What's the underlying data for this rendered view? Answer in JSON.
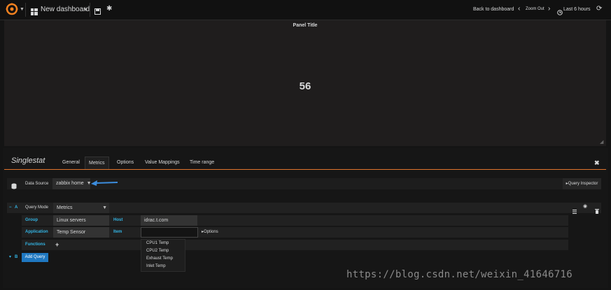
{
  "topnav": {
    "dashboard_title": "New dashboard",
    "back_label": "Back to dashboard",
    "zoom_out_label": "Zoom Out",
    "time_range_label": "Last 6 hours"
  },
  "panel": {
    "title": "Panel Title",
    "value": "56"
  },
  "editor": {
    "panel_type": "Singlestat",
    "tabs": [
      "General",
      "Metrics",
      "Options",
      "Value Mappings",
      "Time range"
    ],
    "active_tab": "Metrics",
    "data_source_label": "Data Source",
    "data_source_value": "zabbix home",
    "query_inspector_label": "Query Inspector"
  },
  "query": {
    "ref_id": "A",
    "query_mode_label": "Query Mode",
    "query_mode_value": "Metrics",
    "group_label": "Group",
    "group_value": "Linux servers",
    "host_label": "Host",
    "host_value": "idrac.t.com",
    "application_label": "Application",
    "application_value": "Temp Sensor",
    "item_label": "Item",
    "item_value": "",
    "options_label": "Options",
    "functions_label": "Functions",
    "item_options": [
      "CPU1 Temp",
      "CPU2 Temp",
      "Exhaust Temp",
      "Inlet Temp"
    ],
    "add_query_ref": "B",
    "add_query_label": "Add Query"
  },
  "watermark": "https://blog.csdn.net/weixin_41646716",
  "colors": {
    "accent_orange": "#e0752d",
    "label_blue": "#33b5e5",
    "button_blue": "#1f78c1",
    "arrow_blue": "#3c8dde"
  }
}
